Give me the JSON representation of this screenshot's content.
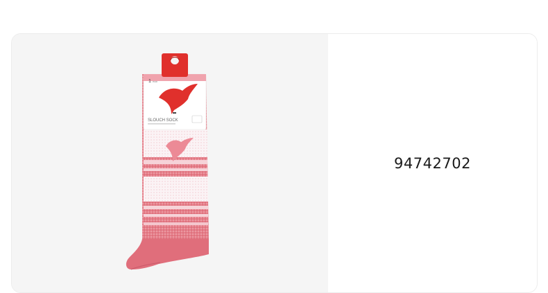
{
  "product": {
    "code": "94742702",
    "image_alt": "Pink and white striped PUMA slouch sock",
    "tag_label": "SLOUCH SOCK",
    "tag_pair_count": "1",
    "tag_pair_unit": "PAIR",
    "brand_color": "#e0302c",
    "sock_pink": "#e2727e",
    "sock_white": "#f9f2f4"
  }
}
